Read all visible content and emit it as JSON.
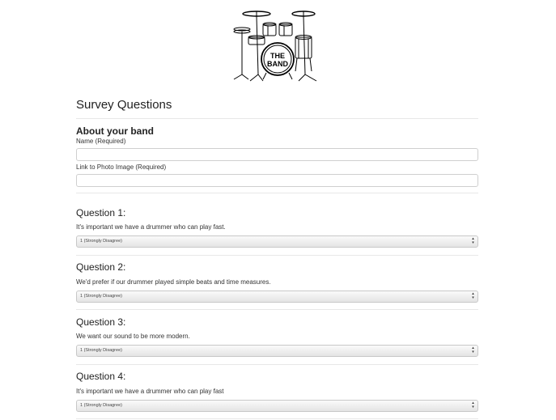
{
  "logo": {
    "line1": "THE",
    "line2": "BAND"
  },
  "survey": {
    "title": "Survey Questions"
  },
  "about": {
    "heading": "About your band",
    "name_label": "Name (Required)",
    "name_value": "",
    "photo_label": "Link to Photo Image (Required)",
    "photo_value": ""
  },
  "questions": [
    {
      "heading": "Question 1:",
      "text": "It's important we have a drummer who can play fast.",
      "selected": "1 (Strongly Disagree)"
    },
    {
      "heading": "Question 2:",
      "text": "We'd prefer if our drummer played simple beats and time measures.",
      "selected": "1 (Strongly Disagree)"
    },
    {
      "heading": "Question 3:",
      "text": "We want our sound to be more modern.",
      "selected": "1 (Strongly Disagree)"
    },
    {
      "heading": "Question 4:",
      "text": "It's important we have a drummer who can play fast",
      "selected": "1 (Strongly Disagree)"
    }
  ],
  "icons": {
    "logo": "drum-kit-logo",
    "select_arrows": "updown-arrows-icon"
  }
}
